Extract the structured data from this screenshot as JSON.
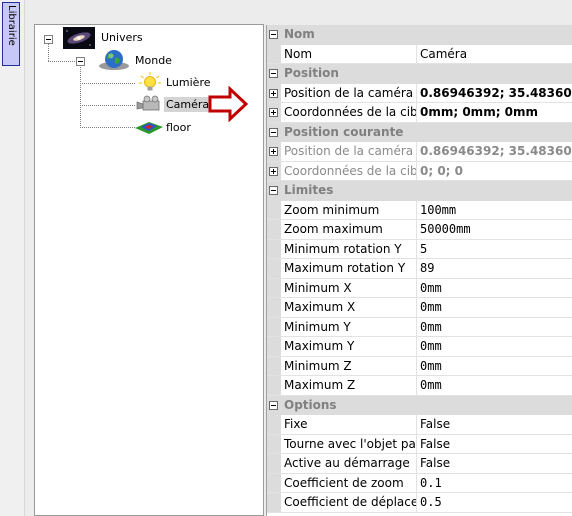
{
  "library_tab": {
    "label": "Librairie"
  },
  "tree": {
    "root": {
      "label": "Univers"
    },
    "world": {
      "label": "Monde"
    },
    "children": [
      {
        "label": "Lumière"
      },
      {
        "label": "Caméra",
        "selected": true
      },
      {
        "label": "floor"
      }
    ]
  },
  "properties": {
    "categories": {
      "nom": "Nom",
      "position": "Position",
      "position_courante": "Position courante",
      "limites": "Limites",
      "options": "Options"
    },
    "nom": {
      "label": "Nom",
      "value": "Caméra"
    },
    "position": {
      "camera": {
        "label": "Position de la caméra",
        "value": "0.86946392; 35.48360"
      },
      "cible": {
        "label": "Coordonnées de la cible",
        "value": "0mm; 0mm; 0mm"
      }
    },
    "position_courante": {
      "camera": {
        "label": "Position de la caméra",
        "value": "0.86946392; 35.48360"
      },
      "cible": {
        "label": "Coordonnées de la cible",
        "value": "0; 0; 0"
      }
    },
    "limites": [
      {
        "label": "Zoom minimum",
        "value": "100mm"
      },
      {
        "label": "Zoom maximum",
        "value": "50000mm"
      },
      {
        "label": "Minimum rotation Y",
        "value": "5"
      },
      {
        "label": "Maximum rotation Y",
        "value": "89"
      },
      {
        "label": "Minimum X",
        "value": "0mm"
      },
      {
        "label": "Maximum X",
        "value": "0mm"
      },
      {
        "label": "Minimum Y",
        "value": "0mm"
      },
      {
        "label": "Maximum Y",
        "value": "0mm"
      },
      {
        "label": "Minimum Z",
        "value": "0mm"
      },
      {
        "label": "Maximum Z",
        "value": "0mm"
      }
    ],
    "options": [
      {
        "label": "Fixe",
        "value": "False"
      },
      {
        "label": "Tourne avec l'objet parent",
        "value": "False"
      },
      {
        "label": "Active au démarrage",
        "value": "False"
      },
      {
        "label": "Coefficient de zoom",
        "value": "0.1"
      },
      {
        "label": "Coefficient de déplacement",
        "value": "0.5"
      }
    ]
  },
  "colors": {
    "arrow": "#c00000",
    "category_bg": "#dcdcdc",
    "selection_bg": "#d4d4d4"
  }
}
